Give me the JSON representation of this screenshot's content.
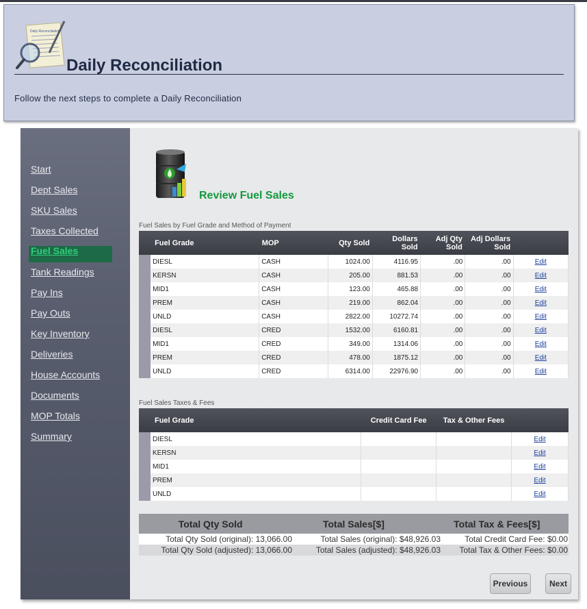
{
  "header": {
    "title": "Daily Reconciliation",
    "subtitle": "Follow the next steps to complete a Daily Reconciliation",
    "icon_text": "Daily Reconciliation"
  },
  "sidebar": {
    "items": [
      {
        "label": "Start",
        "active": false
      },
      {
        "label": "Dept Sales",
        "active": false
      },
      {
        "label": "SKU Sales",
        "active": false
      },
      {
        "label": "Taxes Collected",
        "active": false
      },
      {
        "label": "Fuel Sales",
        "active": true
      },
      {
        "label": "Tank Readings",
        "active": false
      },
      {
        "label": "Pay Ins",
        "active": false
      },
      {
        "label": "Pay Outs",
        "active": false
      },
      {
        "label": "Key Inventory",
        "active": false
      },
      {
        "label": "Deliveries",
        "active": false
      },
      {
        "label": "House Accounts",
        "active": false
      },
      {
        "label": "Documents",
        "active": false
      },
      {
        "label": "MOP Totals",
        "active": false
      },
      {
        "label": "Summary",
        "active": false
      }
    ]
  },
  "main": {
    "title": "Review Fuel Sales",
    "sales_table": {
      "caption": "Fuel Sales by Fuel Grade and Method of Payment",
      "headers": [
        "Fuel Grade",
        "MOP",
        "Qty Sold",
        "Dollars Sold",
        "Adj Qty Sold",
        "Adj Dollars Sold"
      ],
      "rows": [
        [
          "DIESL",
          "CASH",
          "1024.00",
          "4116.95",
          ".00",
          ".00"
        ],
        [
          "KERSN",
          "CASH",
          "205.00",
          "881.53",
          ".00",
          ".00"
        ],
        [
          "MID1",
          "CASH",
          "123.00",
          "465.88",
          ".00",
          ".00"
        ],
        [
          "PREM",
          "CASH",
          "219.00",
          "862.04",
          ".00",
          ".00"
        ],
        [
          "UNLD",
          "CASH",
          "2822.00",
          "10272.74",
          ".00",
          ".00"
        ],
        [
          "DIESL",
          "CRED",
          "1532.00",
          "6160.81",
          ".00",
          ".00"
        ],
        [
          "MID1",
          "CRED",
          "349.00",
          "1314.06",
          ".00",
          ".00"
        ],
        [
          "PREM",
          "CRED",
          "478.00",
          "1875.12",
          ".00",
          ".00"
        ],
        [
          "UNLD",
          "CRED",
          "6314.00",
          "22976.90",
          ".00",
          ".00"
        ]
      ],
      "edit_label": "Edit"
    },
    "fees_table": {
      "caption": "Fuel Sales Taxes & Fees",
      "headers": [
        "Fuel Grade",
        "Credit Card Fee",
        "Tax & Other Fees"
      ],
      "rows": [
        [
          "DIESL",
          "",
          ""
        ],
        [
          "KERSN",
          "",
          ""
        ],
        [
          "MID1",
          "",
          ""
        ],
        [
          "PREM",
          "",
          ""
        ],
        [
          "UNLD",
          "",
          ""
        ]
      ],
      "edit_label": "Edit"
    },
    "totals": {
      "headers": [
        "Total Qty Sold",
        "Total Sales[$]",
        "Total Tax & Fees[$]"
      ],
      "row1": [
        "Total Qty Sold (original): 13,066.00",
        "Total Sales (original): $48,926.03",
        "Total Credit Card Fee: $0.00"
      ],
      "row2": [
        "Total Qty Sold (adjusted): 13,066.00",
        "Total Sales (adjusted): $48,926.03",
        "Total Tax & Other Fees: $0.00"
      ]
    },
    "buttons": {
      "previous": "Previous",
      "next": "Next"
    }
  },
  "colors": {
    "header_bg": "#c9cfe0",
    "sidebar_bg": "#5a5f70",
    "active_item_bg": "#1d6a47",
    "active_item_text": "#2fd07a",
    "page_title": "#139a3e",
    "link_blue": "#1a3e9c"
  }
}
